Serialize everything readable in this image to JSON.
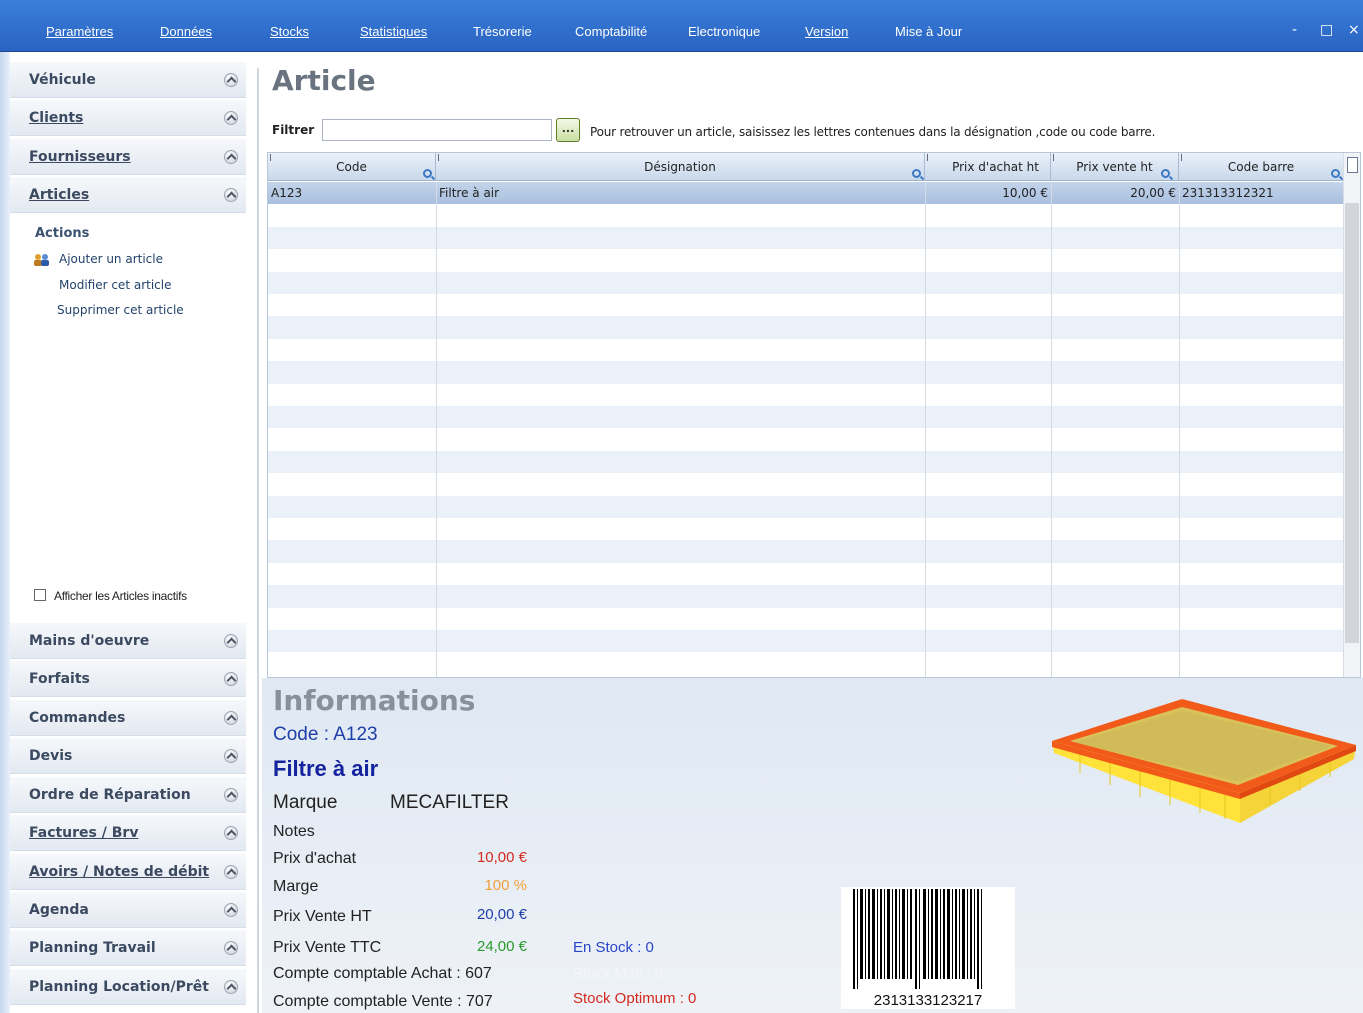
{
  "menu": {
    "items": [
      "Paramètres",
      "Données",
      "Stocks",
      "Statistiques",
      "Trésorerie",
      "Comptabilité",
      "Electronique",
      "Version",
      "Mise à Jour"
    ],
    "minimize": "-",
    "maximize": "□",
    "close": "×"
  },
  "sidebar": {
    "top_items": [
      "Véhicule",
      "Clients",
      "Fournisseurs",
      "Articles"
    ],
    "actions_title": "Actions",
    "actions": [
      "Ajouter un article",
      "Modifier cet article",
      "Supprimer cet article"
    ],
    "inactive_label": "Afficher les Articles inactifs",
    "bottom_items": [
      "Mains d'oeuvre",
      "Forfaits",
      "Commandes",
      "Devis",
      "Ordre de Réparation",
      "Factures / Brv",
      "Avoirs / Notes de débit",
      "Agenda",
      "Planning Travail",
      "Planning Location/Prêt"
    ]
  },
  "main": {
    "title": "Article",
    "filter_label": "Filtrer",
    "filter_value": "",
    "filter_button": "...",
    "filter_hint": "Pour retrouver un article, saisissez les lettres contenues dans la désignation ,code ou code barre."
  },
  "grid": {
    "columns": [
      "Code",
      "Désignation",
      "Prix d'achat ht",
      "Prix vente ht",
      "Code barre"
    ],
    "rows": [
      {
        "code": "A123",
        "designation": "Filtre à air",
        "prix_achat": "10,00 €",
        "prix_vente": "20,00 €",
        "code_barre": "231313312321"
      }
    ]
  },
  "info": {
    "title": "Informations",
    "code": "Code : A123",
    "name": "Filtre à air",
    "brand_label": "Marque",
    "brand_value": "MECAFILTER",
    "notes_label": "Notes",
    "prix_achat_label": "Prix d'achat",
    "prix_achat_value": "10,00 €",
    "marge_label": "Marge",
    "marge_value": "100 %",
    "prix_vente_ht_label": "Prix Vente HT",
    "prix_vente_ht_value": "20,00 €",
    "prix_vente_ttc_label": "Prix Vente TTC",
    "prix_vente_ttc_value": "24,00 €",
    "compte_achat": "Compte comptable Achat : 607",
    "compte_vente": "Compte comptable Vente : 707",
    "en_stock": "En Stock : 0",
    "stock_mini": "Stock Mini : 0",
    "stock_optimum": "Stock Optimum : 0",
    "barcode_text": "2313133123217"
  },
  "colors": {
    "menu_bg": "#2a63c2",
    "prix_achat": "#d42a1f",
    "marge": "#f0a03a",
    "prix_vente_ht": "#1e3fa8",
    "prix_vente_ttc": "#2a9a2a",
    "en_stock": "#2a44c8",
    "stock_mini": "#f4f6f9",
    "stock_optimum": "#d42a1f"
  }
}
